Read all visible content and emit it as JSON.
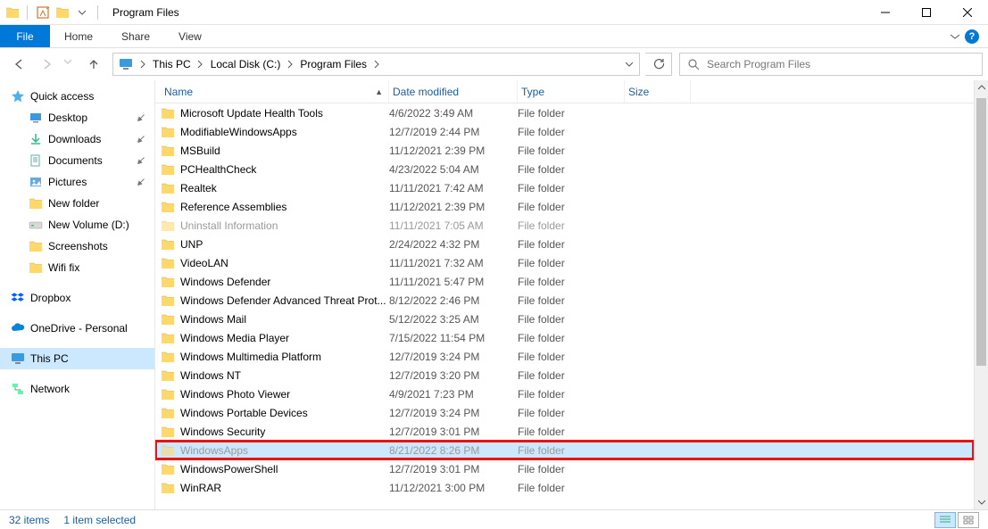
{
  "window": {
    "title": "Program Files"
  },
  "ribbon": {
    "file": "File",
    "tabs": [
      "Home",
      "Share",
      "View"
    ]
  },
  "breadcrumb": {
    "items": [
      "This PC",
      "Local Disk (C:)",
      "Program Files"
    ]
  },
  "search": {
    "placeholder": "Search Program Files"
  },
  "sidebar": {
    "quick_access": "Quick access",
    "quick_items": [
      {
        "label": "Desktop",
        "icon": "desktop",
        "pinned": true
      },
      {
        "label": "Downloads",
        "icon": "downloads",
        "pinned": true
      },
      {
        "label": "Documents",
        "icon": "documents",
        "pinned": true
      },
      {
        "label": "Pictures",
        "icon": "pictures",
        "pinned": true
      },
      {
        "label": "New folder",
        "icon": "folder",
        "pinned": false
      },
      {
        "label": "New Volume (D:)",
        "icon": "drive",
        "pinned": false
      },
      {
        "label": "Screenshots",
        "icon": "folder",
        "pinned": false
      },
      {
        "label": "Wifi fix",
        "icon": "folder",
        "pinned": false
      }
    ],
    "dropbox": "Dropbox",
    "onedrive": "OneDrive - Personal",
    "this_pc": "This PC",
    "network": "Network"
  },
  "columns": {
    "name": "Name",
    "date": "Date modified",
    "type": "Type",
    "size": "Size"
  },
  "rows": [
    {
      "name": "Microsoft Update Health Tools",
      "date": "4/6/2022 3:49 AM",
      "type": "File folder"
    },
    {
      "name": "ModifiableWindowsApps",
      "date": "12/7/2019 2:44 PM",
      "type": "File folder"
    },
    {
      "name": "MSBuild",
      "date": "11/12/2021 2:39 PM",
      "type": "File folder"
    },
    {
      "name": "PCHealthCheck",
      "date": "4/23/2022 5:04 AM",
      "type": "File folder"
    },
    {
      "name": "Realtek",
      "date": "11/11/2021 7:42 AM",
      "type": "File folder"
    },
    {
      "name": "Reference Assemblies",
      "date": "11/12/2021 2:39 PM",
      "type": "File folder"
    },
    {
      "name": "Uninstall Information",
      "date": "11/11/2021 7:05 AM",
      "type": "File folder",
      "faded": true
    },
    {
      "name": "UNP",
      "date": "2/24/2022 4:32 PM",
      "type": "File folder"
    },
    {
      "name": "VideoLAN",
      "date": "11/11/2021 7:32 AM",
      "type": "File folder"
    },
    {
      "name": "Windows Defender",
      "date": "11/11/2021 5:47 PM",
      "type": "File folder"
    },
    {
      "name": "Windows Defender Advanced Threat Prot...",
      "date": "8/12/2022 2:46 PM",
      "type": "File folder"
    },
    {
      "name": "Windows Mail",
      "date": "5/12/2022 3:25 AM",
      "type": "File folder"
    },
    {
      "name": "Windows Media Player",
      "date": "7/15/2022 11:54 PM",
      "type": "File folder"
    },
    {
      "name": "Windows Multimedia Platform",
      "date": "12/7/2019 3:24 PM",
      "type": "File folder"
    },
    {
      "name": "Windows NT",
      "date": "12/7/2019 3:20 PM",
      "type": "File folder"
    },
    {
      "name": "Windows Photo Viewer",
      "date": "4/9/2021 7:23 PM",
      "type": "File folder"
    },
    {
      "name": "Windows Portable Devices",
      "date": "12/7/2019 3:24 PM",
      "type": "File folder"
    },
    {
      "name": "Windows Security",
      "date": "12/7/2019 3:01 PM",
      "type": "File folder"
    },
    {
      "name": "WindowsApps",
      "date": "8/21/2022 8:26 PM",
      "type": "File folder",
      "selected": true,
      "faded": true,
      "highlight": true
    },
    {
      "name": "WindowsPowerShell",
      "date": "12/7/2019 3:01 PM",
      "type": "File folder"
    },
    {
      "name": "WinRAR",
      "date": "11/12/2021 3:00 PM",
      "type": "File folder"
    }
  ],
  "status": {
    "items": "32 items",
    "selected": "1 item selected"
  }
}
